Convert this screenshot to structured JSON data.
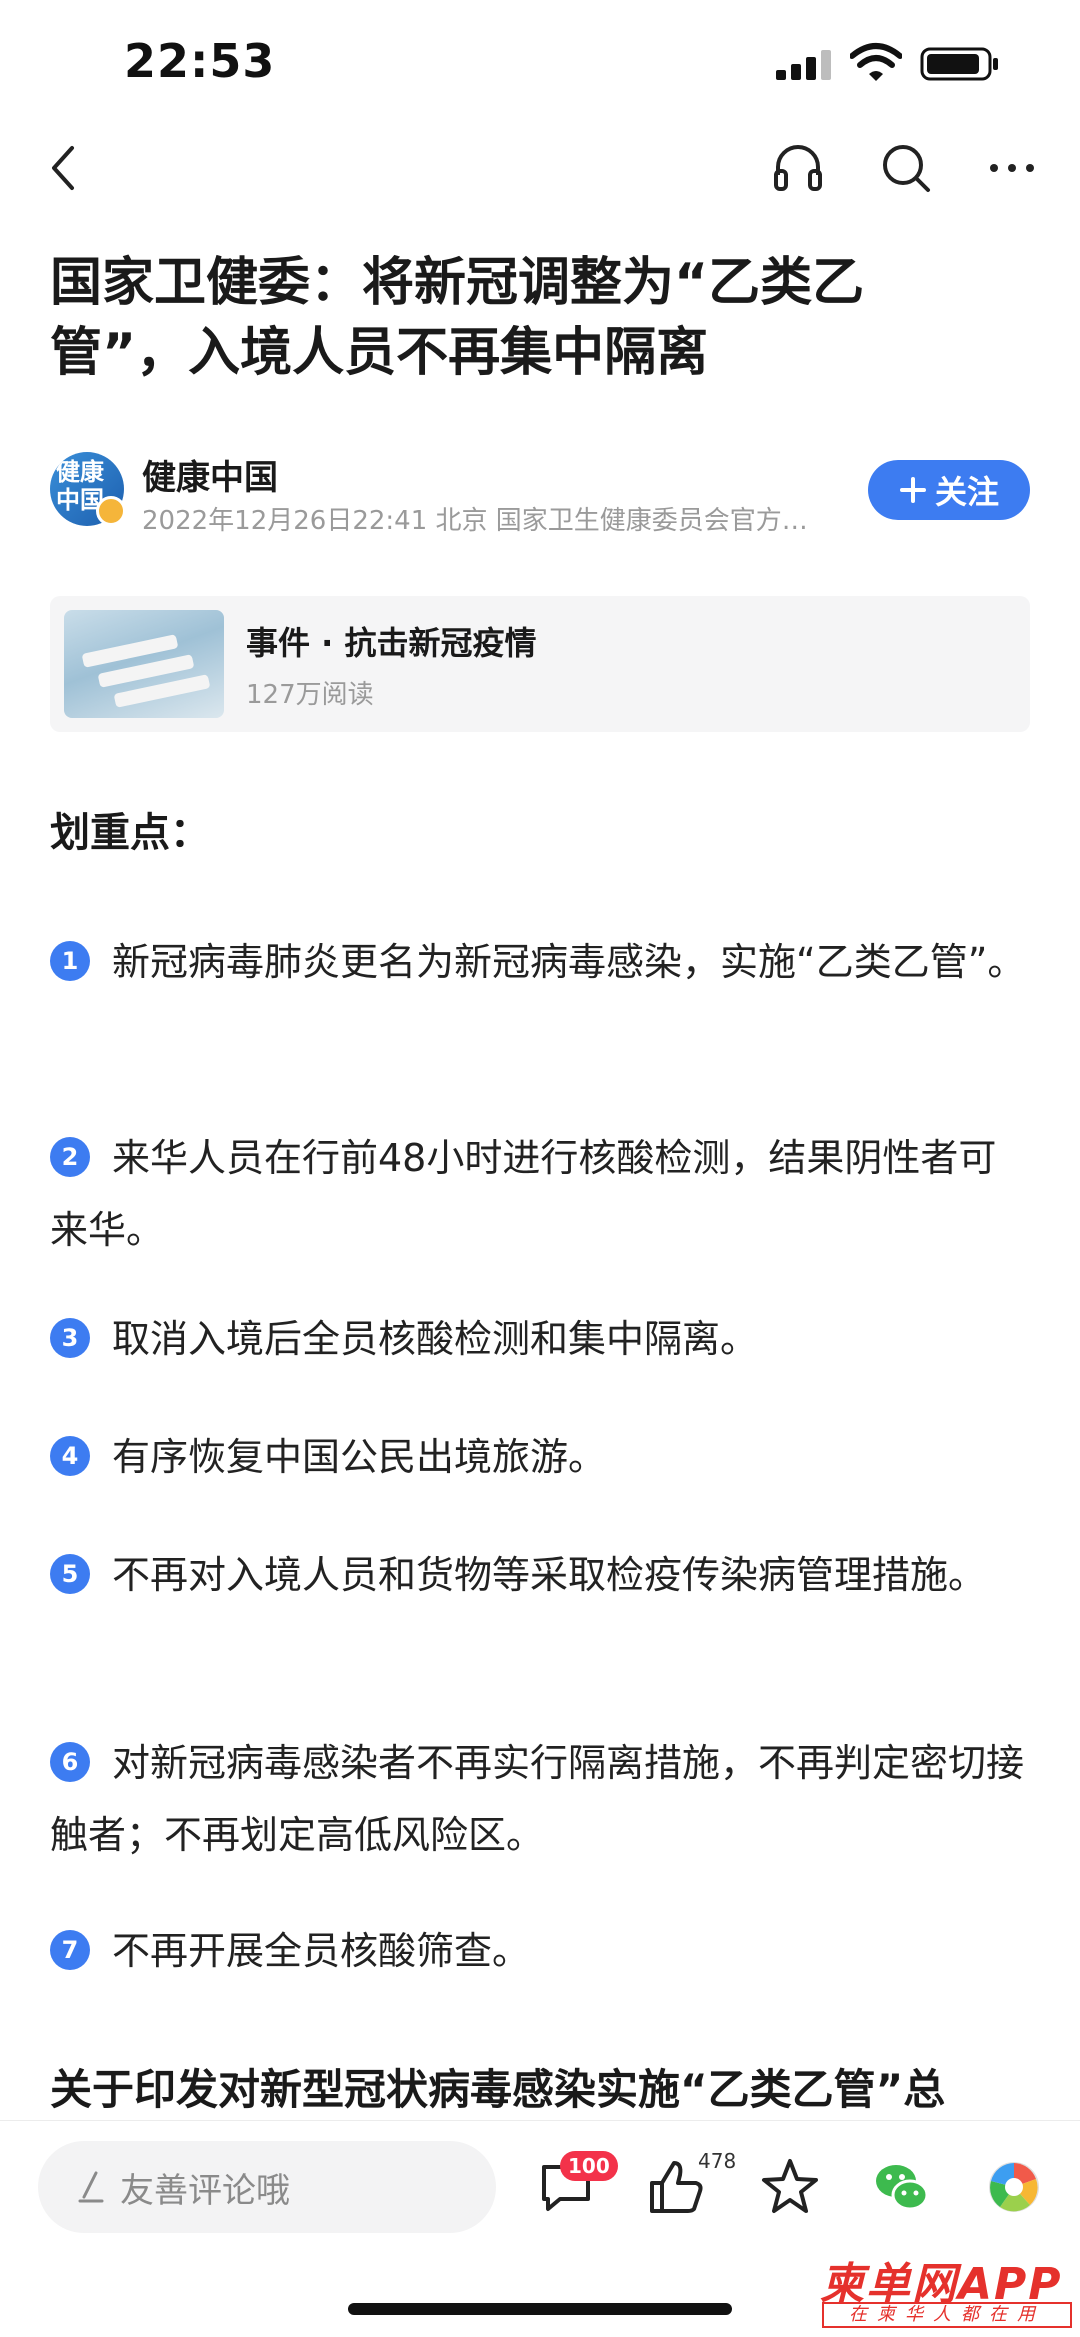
{
  "status_bar": {
    "time": "22:53"
  },
  "article": {
    "title": "国家卫健委：将新冠调整为“乙类乙管”，入境人员不再集中隔离"
  },
  "author": {
    "avatar_text": "健康中国",
    "name": "健康中国",
    "meta": "2022年12月26日22:41 北京 国家卫生健康委员会官方…",
    "follow_label": "关注"
  },
  "event_card": {
    "title": "事件 · 抗击新冠疫情",
    "reads": "127万阅读"
  },
  "key_points": {
    "heading": "划重点：",
    "items": [
      {
        "num": "1",
        "text": "新冠病毒肺炎更名为新冠病毒感染，实施“乙类乙管”。"
      },
      {
        "num": "2",
        "text": "来华人员在行前48小时进行核酸检测，结果阴性者可来华。"
      },
      {
        "num": "3",
        "text": "取消入境后全员核酸检测和集中隔离。"
      },
      {
        "num": "4",
        "text": "有序恢复中国公民出境旅游。"
      },
      {
        "num": "5",
        "text": "不再对入境人员和货物等采取检疫传染病管理措施。"
      },
      {
        "num": "6",
        "text": "对新冠病毒感染者不再实行隔离措施，不再判定密切接触者；不再划定高低风险区。"
      },
      {
        "num": "7",
        "text": "不再开展全员核酸筛查。"
      }
    ]
  },
  "sub_heading": "关于印发对新型冠状病毒感染实施“乙类乙管”总",
  "bottom_bar": {
    "comment_placeholder": "友善评论哦",
    "comment_count": "100",
    "like_count": "478"
  },
  "watermark": {
    "main": "柬单网APP",
    "sub": "在柬华人都在用"
  },
  "colors": {
    "accent": "#3d7cf1",
    "badge": "#f3324a",
    "watermark": "#e5312c"
  },
  "icons": [
    "back-icon",
    "headphones-icon",
    "search-icon",
    "more-icon",
    "pen-icon",
    "comment-icon",
    "like-icon",
    "star-icon",
    "wechat-icon",
    "moments-icon"
  ]
}
